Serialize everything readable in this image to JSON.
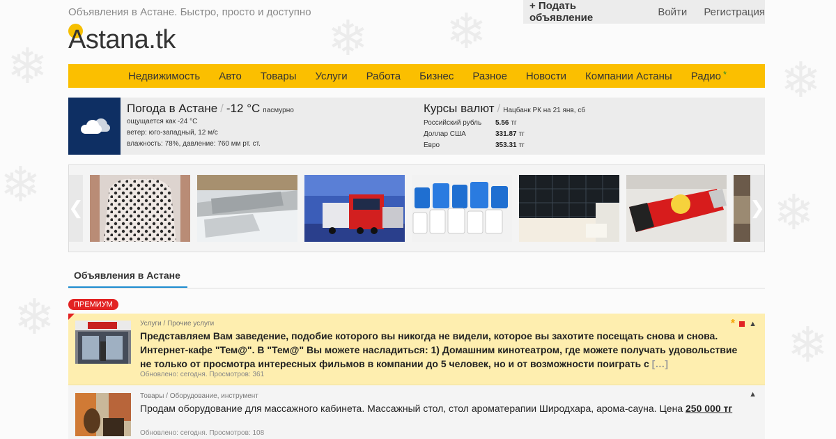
{
  "header": {
    "tagline": "Объявления в Астане. Быстро, просто и доступно",
    "logo": "Astana.tk",
    "nav": {
      "add": "+ Подать объявление",
      "login": "Войти",
      "register": "Регистрация"
    }
  },
  "menu": {
    "items": [
      "Недвижимость",
      "Авто",
      "Товары",
      "Услуги",
      "Работа",
      "Бизнес",
      "Разное",
      "Новости",
      "Компании Астаны",
      "Радио"
    ],
    "radio_star": "*"
  },
  "weather": {
    "title": "Погода в Астане",
    "temp": "-12 °C",
    "condition": "пасмурно",
    "feels": "ощущается как -24 °C",
    "wind": "ветер: юго-западный, 12 м/с",
    "humidity": "влажность: 78%, давление: 760 мм рт. ст.",
    "icon": "cloud-icon"
  },
  "currency": {
    "title": "Курсы валют",
    "source": "Нацбанк РК на 21 янв, сб",
    "rows": [
      {
        "name": "Российский рубль",
        "value": "5.56",
        "unit": "тг"
      },
      {
        "name": "Доллар США",
        "value": "331.87",
        "unit": "тг"
      },
      {
        "name": "Евро",
        "value": "353.31",
        "unit": "тг"
      }
    ]
  },
  "carousel": {
    "left_arrow": "❮",
    "right_arrow": "❯"
  },
  "tabs": {
    "active": "Объявления в Астане"
  },
  "ads": {
    "premium_label": "ПРЕМИУМ",
    "premium": {
      "category": "Услуги / Прочие услуги",
      "text": "Представляем Вам заведение, подобие которого вы никогда не видели, которое вы захотите посещать снова и снова. Интернет-кафе \"Тем@\". В \"Тем@\" Вы можете насладиться: 1) Домашним кинотеатром, где можете получать удовольствие не только от просмотра интересных фильмов в компании до 5 человек, но и от возможности поиграть с",
      "more": "[…]",
      "meta": "Обновлено: сегодня. Просмотров: 361",
      "star": "*",
      "up": "▲"
    },
    "second": {
      "category": "Товары / Оборудование, инструмент",
      "text": "Продам оборудование для массажного кабинета. Массажный стол, стол ароматерапии Широдхара, арома-сауна. Цена",
      "price": "250 000 тг",
      "meta": "Обновлено: сегодня. Просмотров: 108",
      "up": "▲"
    }
  },
  "colors": {
    "menu_bg": "#fbbf00",
    "accent_blue": "#1d8ccf",
    "premium_red": "#e22323",
    "premium_bg": "#feeeaf"
  }
}
